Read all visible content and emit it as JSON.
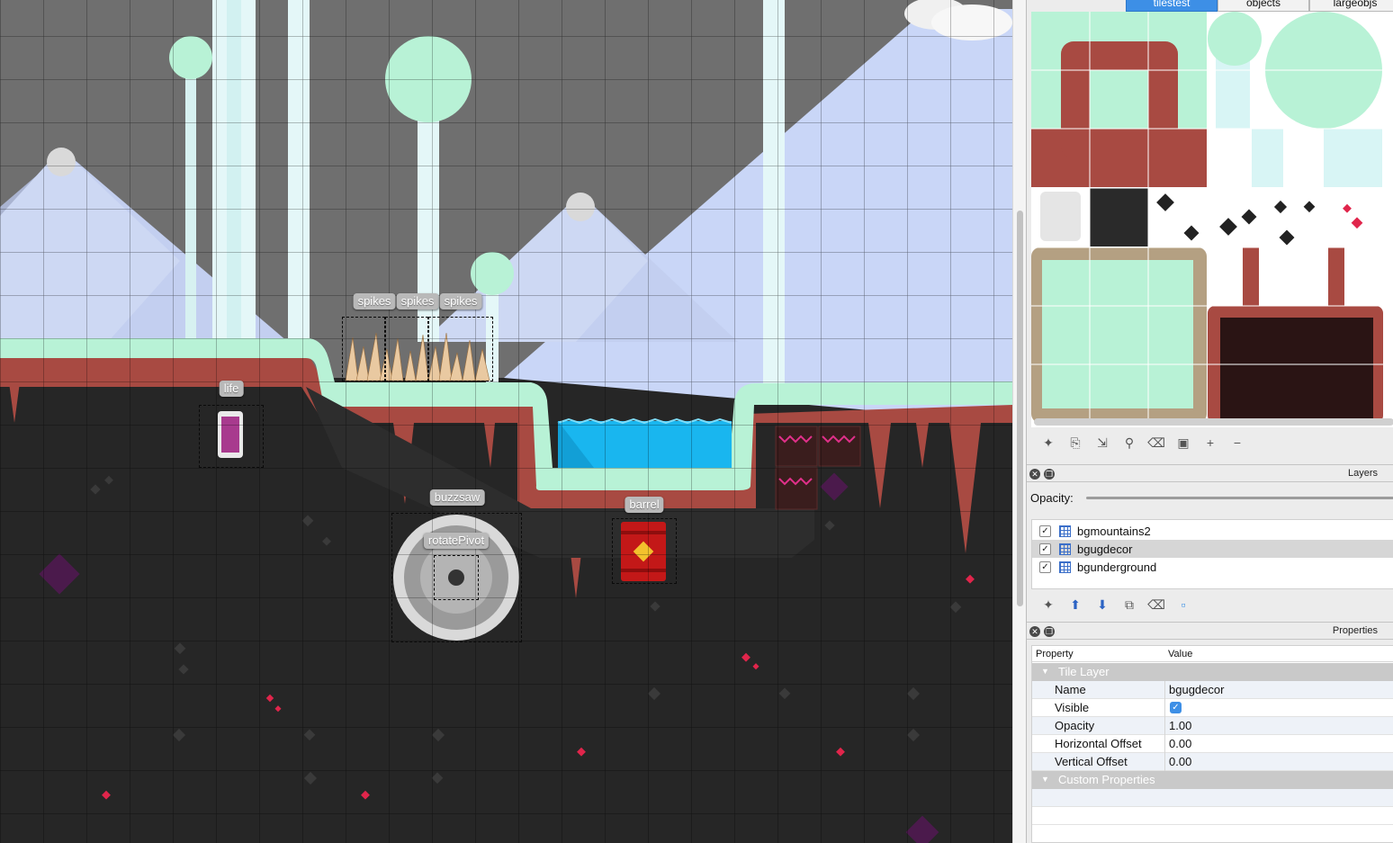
{
  "map": {
    "objects": [
      {
        "label": "spikes"
      },
      {
        "label": "spikes"
      },
      {
        "label": "spikes"
      },
      {
        "label": "life"
      },
      {
        "label": "buzzsaw"
      },
      {
        "label": "rotatePivot"
      },
      {
        "label": "barrel"
      }
    ]
  },
  "tileset_tabs": [
    "tilestest",
    "objects",
    "largeobjs"
  ],
  "layers": {
    "title": "Layers",
    "opacity_label": "Opacity:",
    "items": [
      {
        "name": "bgmountains2",
        "visible": true,
        "selected": false
      },
      {
        "name": "bgugdecor",
        "visible": true,
        "selected": true
      },
      {
        "name": "bgunderground",
        "visible": true,
        "selected": false
      }
    ]
  },
  "properties": {
    "title": "Properties",
    "col_property": "Property",
    "col_value": "Value",
    "group_tile_layer": "Tile Layer",
    "rows": [
      {
        "key": "Name",
        "value": "bgugdecor"
      },
      {
        "key": "Visible",
        "value": ""
      },
      {
        "key": "Opacity",
        "value": "1.00"
      },
      {
        "key": "Horizontal Offset",
        "value": "0.00"
      },
      {
        "key": "Vertical Offset",
        "value": "0.00"
      }
    ],
    "group_custom": "Custom Properties"
  },
  "colors": {
    "accent": "#3d8fe6",
    "grass": "#b8f2d6",
    "dirt": "#a84a42",
    "water": "#19b6ef"
  }
}
